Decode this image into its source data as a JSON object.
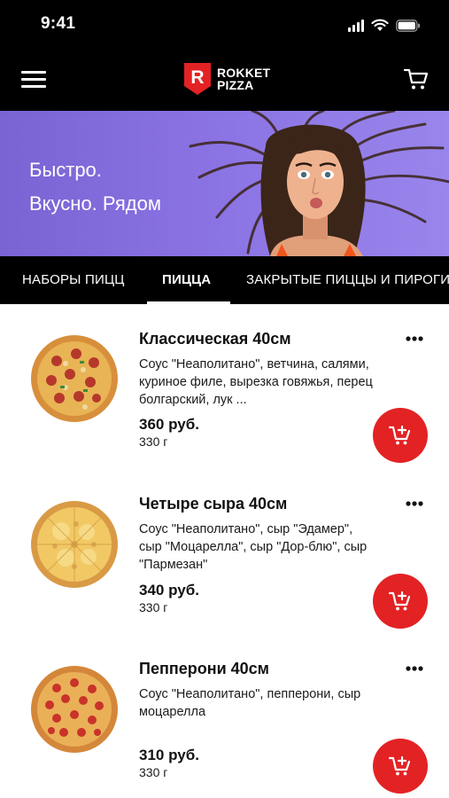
{
  "status_bar": {
    "time": "9:41"
  },
  "header": {
    "logo_line1": "ROKKET",
    "logo_line2": "PIZZA",
    "logo_mark": "R",
    "icons": [
      "menu-icon",
      "cart-icon"
    ]
  },
  "banner": {
    "line1": "Быстро.",
    "line2": "Вкусно. Рядом",
    "background": "#8a72e3"
  },
  "tabs": [
    {
      "label": "НАБОРЫ ПИЦЦ",
      "active": false
    },
    {
      "label": "ПИЦЦА",
      "active": true
    },
    {
      "label": "ЗАКРЫТЫЕ ПИЦЦЫ И ПИРОГИ",
      "active": false
    }
  ],
  "products": [
    {
      "name": "Классическая 40см",
      "description": "Соус \"Неаполитано\", ветчина, салями, куриное филе, вырезка говяжья, перец болгарский, лук ...",
      "price": "360 руб.",
      "weight": "330 г"
    },
    {
      "name": "Четыре сыра 40см",
      "description": "Соус \"Неаполитано\", сыр \"Эдамер\", сыр \"Моцарелла\", сыр \"Дор-блю\", сыр \"Пармезан\"",
      "price": "340 руб.",
      "weight": "330 г"
    },
    {
      "name": "Пепперони 40см",
      "description": "Соус \"Неаполитано\", пепперони, сыр моцарелла",
      "price": "310 руб.",
      "weight": "330 г"
    }
  ],
  "colors": {
    "accent": "#e32224",
    "header_bg": "#000000",
    "banner_bg": "#8a72e3"
  }
}
